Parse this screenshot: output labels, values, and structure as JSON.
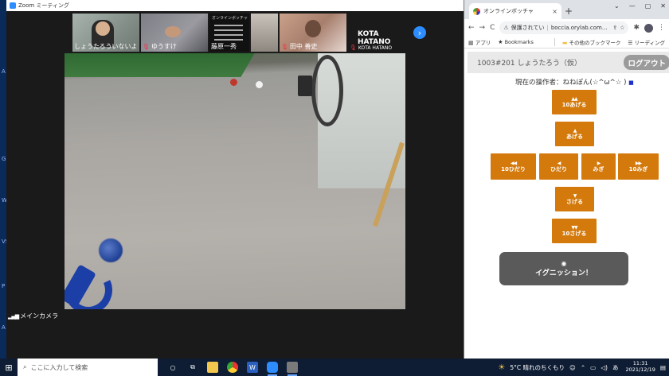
{
  "zoom": {
    "title": "Zoom ミーティング",
    "participants": [
      {
        "name": "しょうたろういないよ",
        "muted": false
      },
      {
        "name": "ゆうすけ",
        "muted": true
      },
      {
        "name": "藤原一秀",
        "muted": false
      },
      {
        "name": "",
        "muted": false
      },
      {
        "name": "田中 善史",
        "muted": true
      },
      {
        "name": "KOTA HATANO",
        "muted": true,
        "big_label": "KOTA HATANO"
      }
    ],
    "thumb3_title": "オンラインボッチャ",
    "camera_label": "メインカメラ"
  },
  "chrome": {
    "tab_title": "オンラインボッチャ",
    "tab_close": "×",
    "new_tab": "+",
    "window_controls": [
      "⌄",
      "—",
      "▢",
      "✕"
    ],
    "nav": {
      "back": "←",
      "forward": "→",
      "reload": "C"
    },
    "omnibox_warning": "保護されてい",
    "omnibox_url": "boccia.orylab.com...",
    "bookmarks": [
      {
        "icon": "apps-grid-icon",
        "label": "アプリ"
      },
      {
        "icon": "star-icon",
        "label": "Bookmarks"
      },
      {
        "icon": "folder-icon",
        "label": "その他のブックマーク"
      },
      {
        "icon": "reading-list-icon",
        "label": "リーディング"
      }
    ]
  },
  "app": {
    "room_label": "1003#201  しょうたろう（仮）",
    "logout_label": "ログアウト",
    "operator_text": "現在の操作者：ねねぽん(☆^ω^☆ )",
    "controls": {
      "up10": {
        "arrow": "▲▲",
        "label": "10あげる"
      },
      "up": {
        "arrow": "▲",
        "label": "あげる"
      },
      "left10": {
        "arrow": "◀◀",
        "label": "10ひだり"
      },
      "left": {
        "arrow": "◀",
        "label": "ひだり"
      },
      "right": {
        "arrow": "▶",
        "label": "みぎ"
      },
      "right10": {
        "arrow": "▶▶",
        "label": "10みぎ"
      },
      "down": {
        "arrow": "▼",
        "label": "さげる"
      },
      "down10": {
        "arrow": "▼▼",
        "label": "10さげる"
      }
    },
    "ignite": {
      "symbol": "◉",
      "label": "イグニッション！"
    }
  },
  "taskbar": {
    "search_placeholder": "ここに入力して検索",
    "weather": "5°C  晴れのちくもり",
    "time": "11:31",
    "date": "2021/12/19",
    "ime": "あ"
  },
  "colors": {
    "control_button": "#d47a0c",
    "ignite_button": "#5a5a5a",
    "logout_button": "#9b9b9b",
    "zoom_accent": "#2d8cff",
    "taskbar": "#0e1d34"
  }
}
